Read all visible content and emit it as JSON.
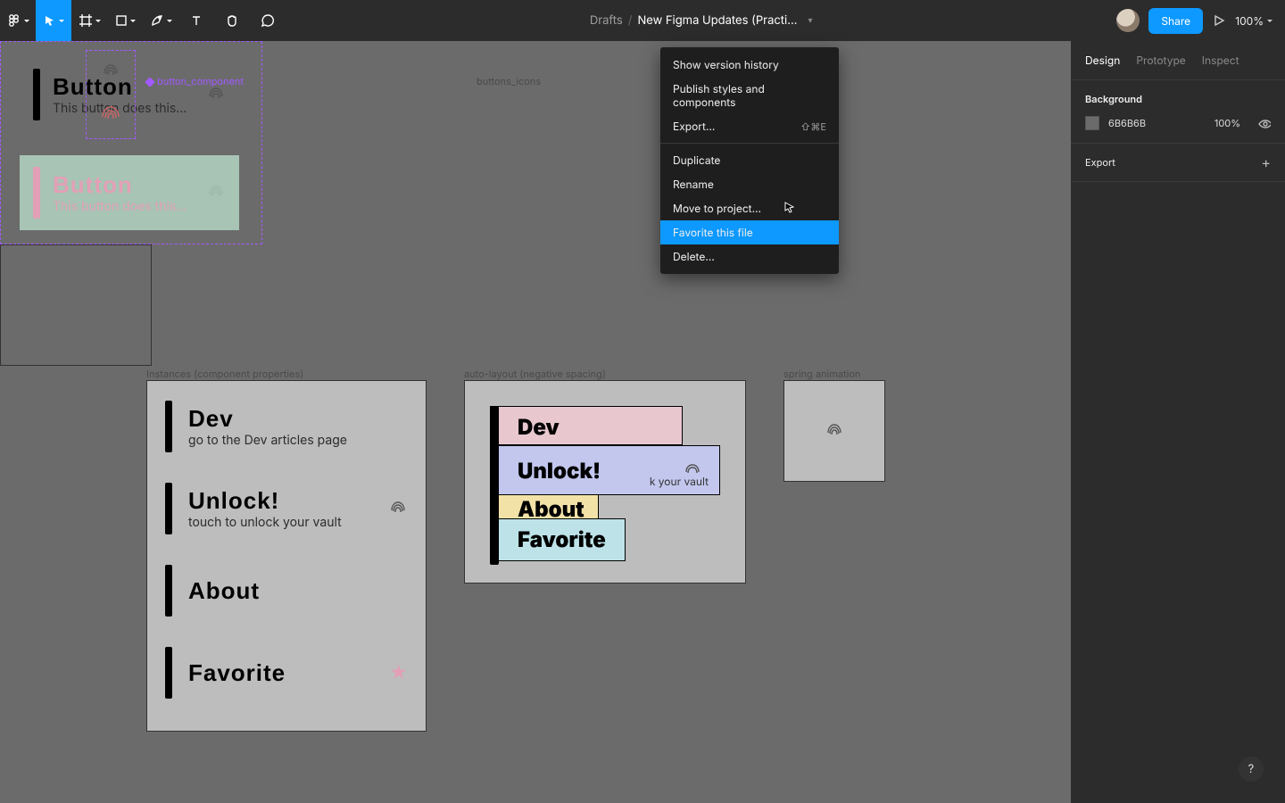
{
  "toolbar": {
    "drafts": "Drafts",
    "filename": "New Figma Updates (Practi…",
    "share": "Share",
    "zoom": "100%"
  },
  "panel": {
    "tabs": [
      "Design",
      "Prototype",
      "Inspect"
    ],
    "background_label": "Background",
    "background_hex": "6B6B6B",
    "background_opacity": "100%",
    "export_label": "Export"
  },
  "menu": {
    "items": [
      {
        "label": "Show version history",
        "shortcut": ""
      },
      {
        "label": "Publish styles and components",
        "shortcut": ""
      },
      {
        "label": "Export…",
        "shortcut": "⇧⌘E"
      }
    ],
    "items2": [
      {
        "label": "Duplicate"
      },
      {
        "label": "Rename"
      },
      {
        "label": "Move to project…"
      },
      {
        "label": "Favorite this file"
      },
      {
        "label": "Delete…"
      }
    ],
    "hover_index": 3
  },
  "frames": {
    "button_component": {
      "label": "button_component",
      "card1": {
        "title": "Button",
        "subtitle": "This button does this…"
      },
      "card2": {
        "title": "Button",
        "subtitle": "This button does this…"
      }
    },
    "buttons_icons": {
      "label": "buttons_icons"
    },
    "instances": {
      "label": "Instances (component properties)",
      "items": [
        {
          "title": "Dev",
          "subtitle": "go to the Dev articles page",
          "icon": ""
        },
        {
          "title": "Unlock!",
          "subtitle": "touch to unlock your vault",
          "icon": "fingerprint"
        },
        {
          "title": "About",
          "subtitle": "",
          "icon": ""
        },
        {
          "title": "Favorite",
          "subtitle": "",
          "icon": "star"
        }
      ]
    },
    "autolayout": {
      "label": "auto-layout (negative spacing)",
      "cards": [
        "Dev",
        "Unlock!",
        "About",
        "Favorite"
      ],
      "unlock_sub": "k your vault"
    },
    "spring": {
      "label": "spring animation"
    }
  },
  "help": "?"
}
